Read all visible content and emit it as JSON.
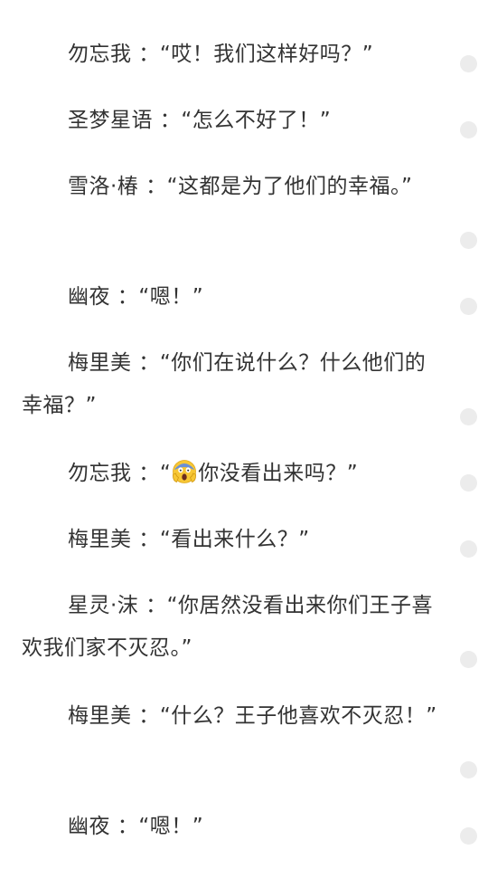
{
  "paragraphs": [
    {
      "speaker": "勿忘我",
      "sep": " ：",
      "quote": "“哎！我们这样好吗？”"
    },
    {
      "speaker": "圣梦星语",
      "sep": " ：",
      "quote": "“怎么不好了！”"
    },
    {
      "speaker": "雪洛·椿",
      "sep": " ：",
      "quote": "“这都是为了他们的幸福。”"
    },
    {
      "speaker": "幽夜",
      "sep": " ：",
      "quote": "“嗯！”"
    },
    {
      "speaker": "梅里美",
      "sep": " ：",
      "quote": "“你们在说什么？什么他们的幸福？”"
    },
    {
      "speaker": "勿忘我",
      "sep": " ：",
      "quote_open": "“",
      "emoji": "scream-face-emoji",
      "quote": "你没看出来吗？”"
    },
    {
      "speaker": "梅里美",
      "sep": " ：",
      "quote": "“看出来什么？”"
    },
    {
      "speaker": "星灵·沫",
      "sep": " ：",
      "quote": "“你居然没看出来你们王子喜欢我们家不灭忍。”"
    },
    {
      "speaker": "梅里美",
      "sep": " ：",
      "quote": "“什么？王子他喜欢不灭忍！”"
    },
    {
      "speaker": "幽夜",
      "sep": " ：",
      "quote": "“嗯！”"
    }
  ],
  "colors": {
    "text": "#333333",
    "background": "#ffffff",
    "comment_dot": "#ececec"
  }
}
